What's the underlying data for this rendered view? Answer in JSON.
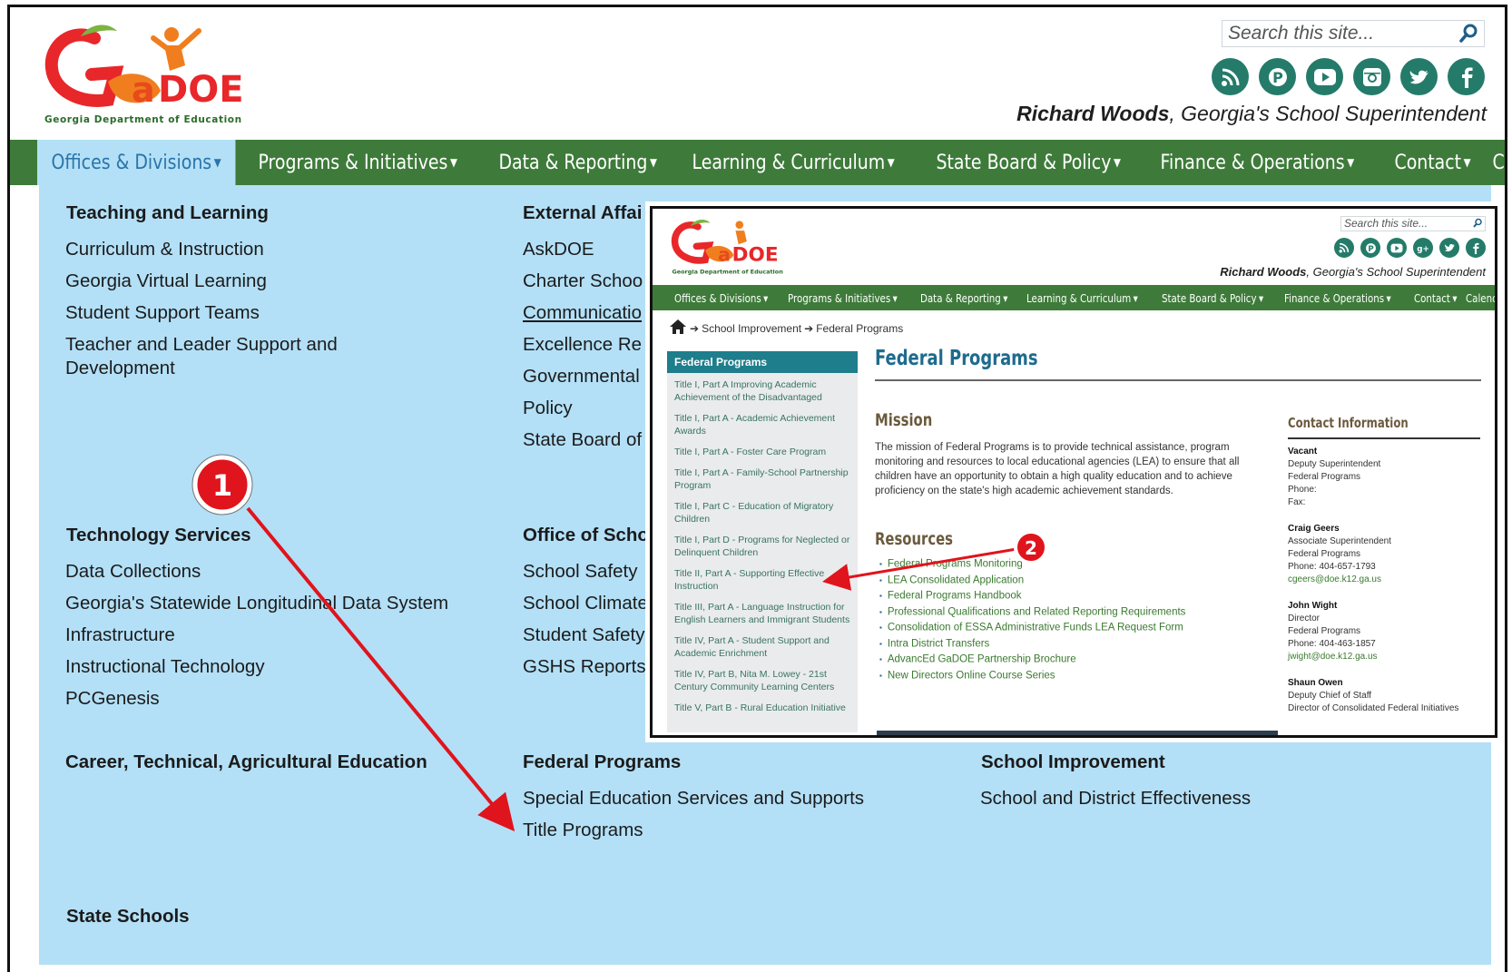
{
  "header": {
    "logo_text": "Georgia Department of Education",
    "search_placeholder": "Search this site...",
    "superintendent_name": "Richard Woods",
    "superintendent_title": ", Georgia's School Superintendent",
    "social_icons": [
      "rss-icon",
      "pinterest-icon",
      "youtube-icon",
      "instagram-icon",
      "twitter-icon",
      "facebook-icon"
    ]
  },
  "nav": {
    "items": [
      {
        "label": "Offices & Divisions",
        "active": true
      },
      {
        "label": "Programs & Initiatives"
      },
      {
        "label": "Data & Reporting"
      },
      {
        "label": "Learning & Curriculum"
      },
      {
        "label": "State Board & Policy"
      },
      {
        "label": "Finance & Operations"
      },
      {
        "label": "Contact"
      },
      {
        "label": "Calendar"
      }
    ]
  },
  "mega": {
    "teaching": {
      "heading": "Teaching and Learning",
      "links": [
        "Curriculum & Instruction",
        "Georgia Virtual Learning",
        "Student Support Teams",
        "Teacher and Leader Support and Development"
      ]
    },
    "external": {
      "heading": "External Affai",
      "links": [
        "AskDOE",
        "Charter Schoo",
        "Communicatio",
        "Excellence Re",
        "Governmental",
        "Policy",
        "State Board of"
      ]
    },
    "technology": {
      "heading": "Technology Services",
      "links": [
        "Data Collections",
        "Georgia's Statewide Longitudinal Data System",
        "Infrastructure",
        "Instructional Technology",
        "PCGenesis"
      ]
    },
    "school_safety": {
      "heading": "Office of Scho",
      "links": [
        "School Safety",
        "School Climate",
        "Student Safety",
        "GSHS Reports"
      ]
    },
    "ctae": {
      "heading": "Career, Technical, Agricultural Education"
    },
    "federal": {
      "heading": "Federal Programs",
      "links": [
        "Special Education Services and Supports",
        "Title Programs"
      ]
    },
    "improvement": {
      "heading": "School Improvement",
      "links": [
        "School and District Effectiveness"
      ]
    },
    "state_schools": {
      "heading": "State Schools"
    }
  },
  "inset": {
    "search_placeholder": "Search this site...",
    "superintendent_name": "Richard Woods",
    "superintendent_title": ", Georgia's School Superintendent",
    "nav": [
      "Offices & Divisions",
      "Programs & Initiatives",
      "Data & Reporting",
      "Learning & Curriculum",
      "State Board & Policy",
      "Finance & Operations",
      "Contact",
      "Calendar"
    ],
    "breadcrumb": [
      "School Improvement",
      "Federal Programs"
    ],
    "sidebar_heading": "Federal Programs",
    "sidebar_items": [
      "Title I, Part A Improving Academic Achievement of the Disadvantaged",
      "Title I, Part A - Academic Achievement Awards",
      "Title I, Part A - Foster Care Program",
      "Title I, Part A - Family-School Partnership Program",
      "Title I, Part C - Education of Migratory Children",
      "Title I, Part D - Programs for Neglected or Delinquent Children",
      "Title II, Part A - Supporting Effective Instruction",
      "Title III, Part A - Language Instruction for English Learners and Immigrant Students",
      "Title IV, Part A - Student Support and Academic Enrichment",
      "Title IV, Part B, Nita M. Lowey - 21st Century Community Learning Centers",
      "Title V, Part B - Rural Education Initiative"
    ],
    "page_title": "Federal Programs",
    "mission_heading": "Mission",
    "mission_text": "The mission of Federal Programs is to provide technical assistance, program monitoring and resources to local educational agencies (LEA) to ensure that all children have an opportunity to obtain a high quality education and to achieve proficiency on the state's high academic achievement standards.",
    "resources_heading": "Resources",
    "resources": [
      "Federal Programs Monitoring",
      "LEA Consolidated Application",
      "Federal Programs Handbook",
      "Professional Qualifications and Related Reporting Requirements",
      "Consolidation of ESSA Administrative Funds LEA Request Form",
      "Intra District Transfers",
      "AdvancEd GaDOE Partnership Brochure",
      "New Directors Online Course Series"
    ],
    "contact_heading": "Contact Information",
    "contacts": [
      {
        "name": "Vacant",
        "lines": [
          "Deputy Superintendent",
          "Federal Programs",
          "Phone:",
          "Fax:"
        ]
      },
      {
        "name": "Craig Geers",
        "lines": [
          "Associate Superintendent",
          "Federal Programs",
          "Phone: 404-657-1793"
        ],
        "email": "cgeers@doe.k12.ga.us"
      },
      {
        "name": "John Wight",
        "lines": [
          "Director",
          "Federal Programs",
          "Phone: 404-463-1857"
        ],
        "email": "jwight@doe.k12.ga.us"
      },
      {
        "name": "Shaun Owen",
        "lines": [
          "Deputy Chief of Staff",
          "Director of Consolidated Federal Initiatives"
        ]
      }
    ]
  },
  "annotations": {
    "step1": "1",
    "step2": "2",
    "color": "#e0141c"
  },
  "colors": {
    "nav_green": "#3e7b3a",
    "menu_blue": "#b3e0f7",
    "social_teal": "#247b69",
    "active_tab_text": "#2a74a8"
  }
}
